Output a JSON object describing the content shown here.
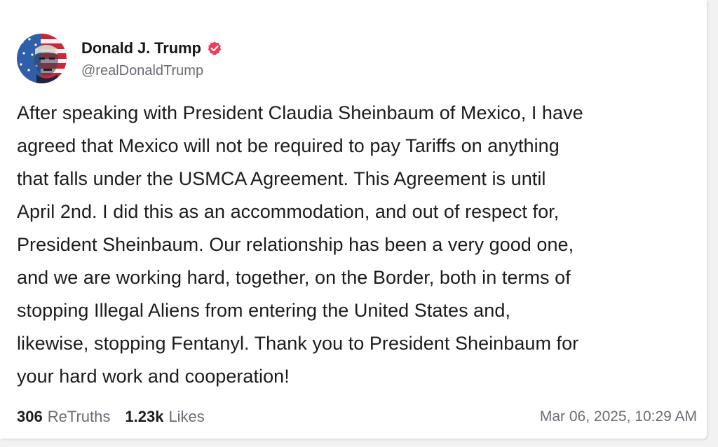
{
  "post": {
    "author": {
      "display_name": "Donald J. Trump",
      "handle": "@realDonaldTrump",
      "verified": true,
      "verified_color": "#e4405f"
    },
    "text": "After speaking with President Claudia Sheinbaum of Mexico, I have\nagreed that Mexico will not be required to pay Tariffs on anything\nthat falls under the USMCA Agreement. This Agreement is until\nApril 2nd. I did this as an accommodation, and out of respect for,\nPresident Sheinbaum. Our relationship has been a very good one,\nand we are working hard, together, on the Border, both in terms of\nstopping Illegal Aliens from entering the United States and,\nlikewise, stopping Fentanyl. Thank you to President Sheinbaum for\nyour hard work and cooperation!",
    "stats": {
      "retruths_count": "306",
      "retruths_label": "ReTruths",
      "likes_count": "1.23k",
      "likes_label": "Likes"
    },
    "timestamp": "Mar 06, 2025, 10:29 AM"
  },
  "colors": {
    "text": "#1c1c1e",
    "muted": "#6b6b73",
    "background": "#ffffff"
  }
}
